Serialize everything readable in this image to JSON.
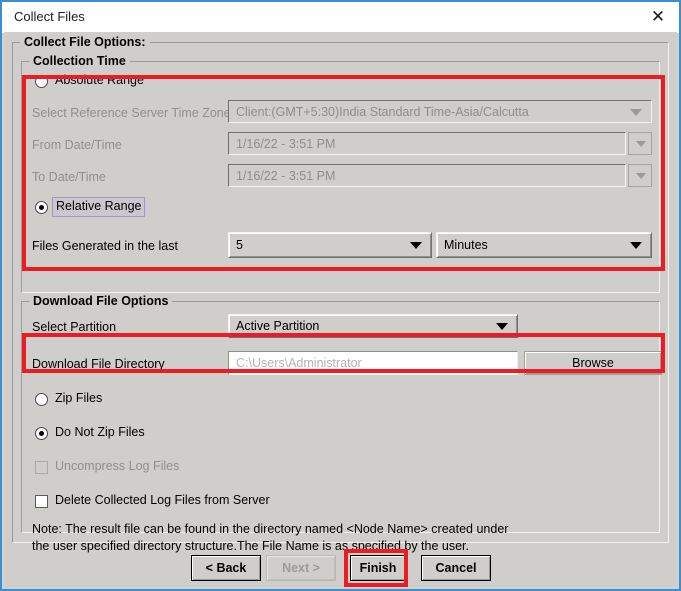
{
  "window": {
    "title": "Collect Files",
    "close_icon": "close-x-icon"
  },
  "groups": {
    "collect_file_options": "Collect File Options:",
    "collection_time": "Collection Time",
    "download_file_options": "Download File Options"
  },
  "collection_time": {
    "absolute_range": {
      "label": "Absolute Range",
      "selected": false,
      "enabled": true
    },
    "timezone": {
      "label": "Select Reference Server Time Zone",
      "value": "Client:(GMT+5:30)India Standard Time-Asia/Calcutta",
      "enabled": false
    },
    "from_datetime": {
      "label": "From Date/Time",
      "value": "1/16/22 - 3:51 PM",
      "enabled": false
    },
    "to_datetime": {
      "label": "To Date/Time",
      "value": "1/16/22 - 3:51 PM",
      "enabled": false
    },
    "relative_range": {
      "label": "Relative Range",
      "selected": true,
      "enabled": true,
      "focused": true
    },
    "files_generated": {
      "label": "Files Generated in the last",
      "amount_value": "5",
      "unit_value": "Minutes"
    }
  },
  "download_options": {
    "select_partition": {
      "label": "Select Partition",
      "value": "Active Partition"
    },
    "download_directory": {
      "label": "Download File Directory",
      "value": "",
      "placeholder": "C:\\Users\\Administrator",
      "browse_label": "Browse"
    },
    "zip_files": {
      "label": "Zip Files",
      "selected": false,
      "enabled": true
    },
    "do_not_zip_files": {
      "label": "Do Not Zip Files",
      "selected": true,
      "enabled": true
    },
    "uncompress_log_files": {
      "label": "Uncompress Log Files",
      "checked": false,
      "enabled": false
    },
    "delete_collected_log_files": {
      "label": "Delete Collected Log Files from Server",
      "checked": false,
      "enabled": true
    },
    "note": "Note: The result file can be found in the directory named <Node Name> created under\nthe user specified directory structure.The File Name is as specified by the user."
  },
  "footer": {
    "back_label": "< Back",
    "next_label": "Next >",
    "finish_label": "Finish",
    "cancel_label": "Cancel"
  },
  "annotations": {
    "highlight_color": "#ec1c24",
    "regions": [
      "collection-time-range",
      "download-file-directory",
      "finish-button"
    ]
  },
  "colors": {
    "window_border": "#3a8fd0",
    "panel_background": "#d0cecb",
    "titlebar_background": "#ffffff",
    "disabled_text": "#8d8d8a"
  }
}
